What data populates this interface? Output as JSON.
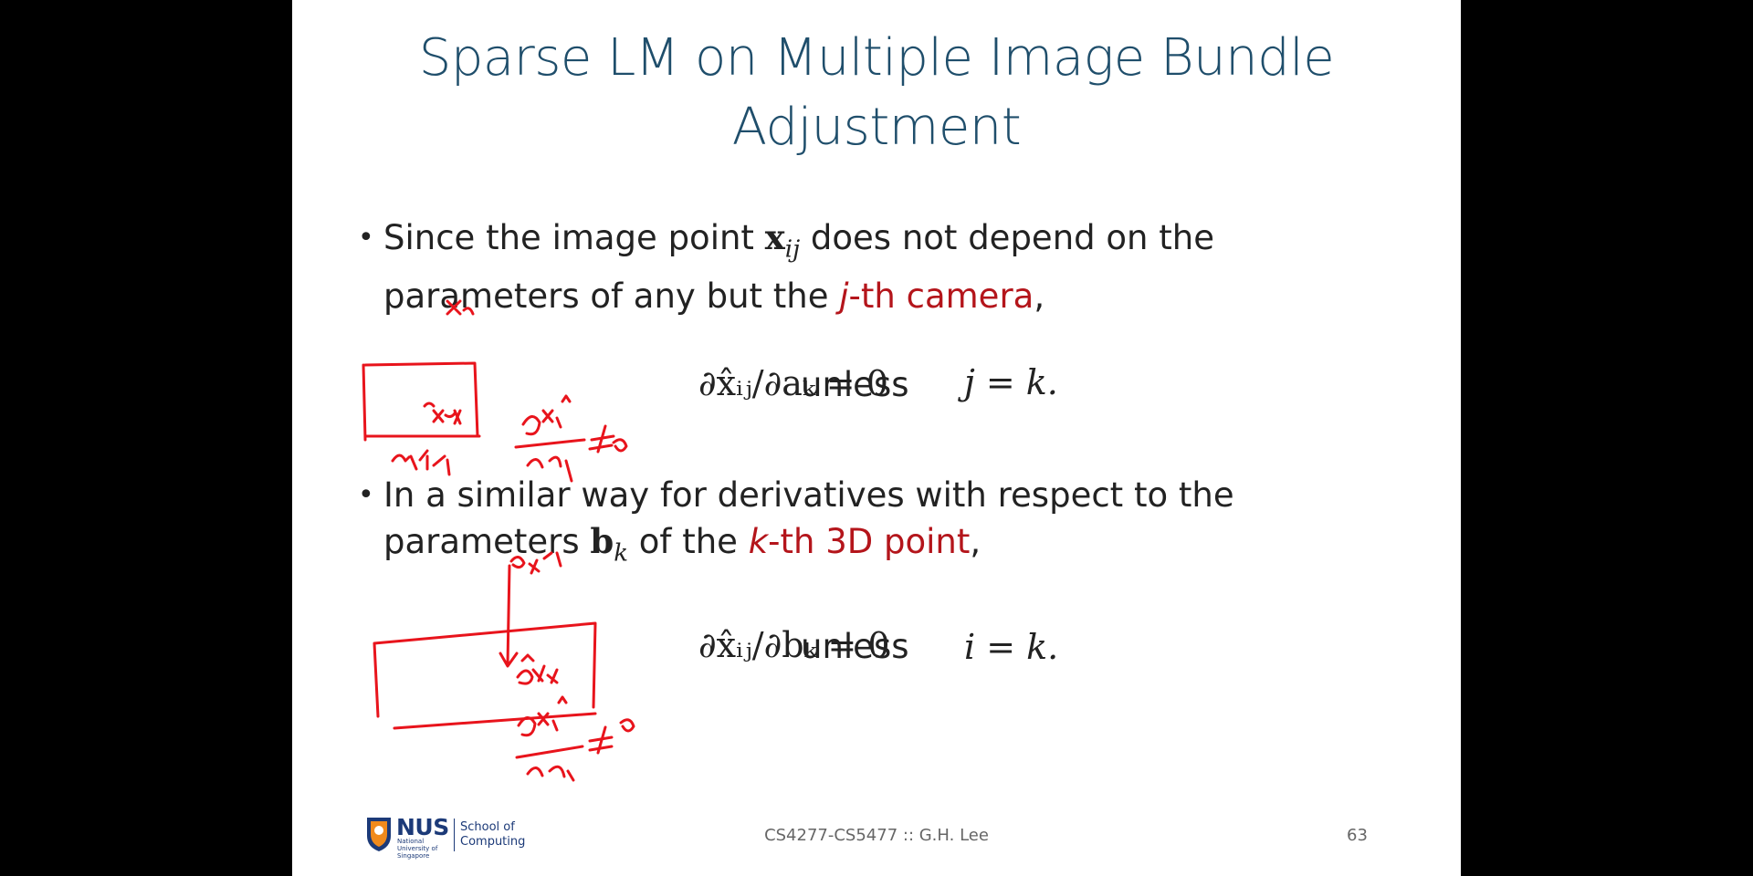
{
  "slide": {
    "title_line1": "Sparse LM on Multiple Image Bundle",
    "title_line2": "Adjustment",
    "bullet1": {
      "text_a": "Since the image point ",
      "math_x": "x",
      "math_sub": "ij",
      "text_b": " does not depend on the",
      "text_c": "parameters of any but the ",
      "red_j": "j",
      "red_rest": "-th camera",
      "text_d": ","
    },
    "eq1": {
      "lhs": "∂x̂ᵢⱼ/∂aₖ = 0",
      "unless": "unless",
      "cond": "j = k."
    },
    "bullet2": {
      "text_a": "In a similar way for derivatives with respect to the",
      "text_b": "parameters ",
      "math_b": "b",
      "math_sub": "k",
      "text_c": " of the ",
      "red_k": "k",
      "red_rest": "-th 3D point",
      "text_d": ","
    },
    "eq2": {
      "lhs": "∂x̂ᵢⱼ/∂bₖ = 0",
      "unless": "unless",
      "cond": "i = k."
    }
  },
  "footer": {
    "course": "CS4277-CS5477 :: G.H. Lee",
    "page": "63",
    "logo_nus": "NUS",
    "logo_uni": "National University of Singapore",
    "logo_school": "School of Computing"
  },
  "colors": {
    "title": "#1f4e6b",
    "accent_red": "#b4151b",
    "ink": "#e8141c",
    "background": "#000000"
  }
}
